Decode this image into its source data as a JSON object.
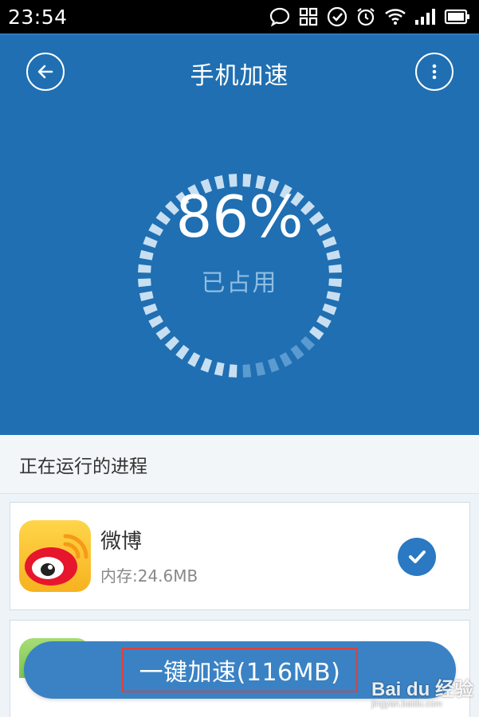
{
  "status_bar": {
    "time": "23:54",
    "icons": [
      "chat-bubble-icon",
      "apps-grid-icon",
      "check-circle-icon",
      "alarm-icon",
      "wifi-icon",
      "signal-icon",
      "battery-icon"
    ]
  },
  "header": {
    "title": "手机加速",
    "back_icon": "back-arrow-icon",
    "more_icon": "more-vertical-icon"
  },
  "gauge": {
    "value": "86%",
    "percent": 86,
    "label": "已占用"
  },
  "processes": {
    "section_title": "正在运行的进程",
    "items": [
      {
        "name": "微博",
        "memory": "内存:24.6MB",
        "checked": true,
        "icon": "weibo-icon"
      }
    ]
  },
  "action": {
    "boost_label": "一键加速(116MB)"
  },
  "watermark": {
    "logo": "Bai du 经验",
    "sub": "jingyan.baidu.com"
  },
  "colors": {
    "primary": "#1f6fb2",
    "button": "#3a82c4",
    "gauge_track": "#5b9bd0",
    "gauge_fill": "#c8dff2",
    "check": "#2a79c2"
  }
}
